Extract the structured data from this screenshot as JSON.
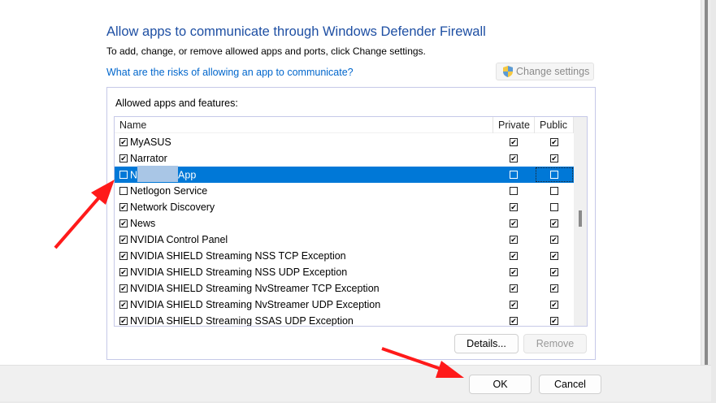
{
  "title": "Allow apps to communicate through Windows Defender Firewall",
  "subtitle": "To add, change, or remove allowed apps and ports, click Change settings.",
  "risk_link": "What are the risks of allowing an app to communicate?",
  "change_settings": "Change settings",
  "group_label": "Allowed apps and features:",
  "columns": {
    "name": "Name",
    "private": "Private",
    "public": "Public"
  },
  "rows": [
    {
      "name": "MyASUS",
      "enabled": true,
      "private": true,
      "public": true
    },
    {
      "name": "Narrator",
      "enabled": true,
      "private": true,
      "public": true
    },
    {
      "name_prefix": "N",
      "name": "App",
      "enabled": false,
      "private": false,
      "public": false,
      "selected": true
    },
    {
      "name": "Netlogon Service",
      "enabled": false,
      "private": false,
      "public": false
    },
    {
      "name": "Network Discovery",
      "enabled": true,
      "private": true,
      "public": false
    },
    {
      "name": "News",
      "enabled": true,
      "private": true,
      "public": true
    },
    {
      "name": "NVIDIA Control Panel",
      "enabled": true,
      "private": true,
      "public": true
    },
    {
      "name": "NVIDIA SHIELD Streaming NSS TCP Exception",
      "enabled": true,
      "private": true,
      "public": true
    },
    {
      "name": "NVIDIA SHIELD Streaming NSS UDP Exception",
      "enabled": true,
      "private": true,
      "public": true
    },
    {
      "name": "NVIDIA SHIELD Streaming NvStreamer TCP Exception",
      "enabled": true,
      "private": true,
      "public": true
    },
    {
      "name": "NVIDIA SHIELD Streaming NvStreamer UDP Exception",
      "enabled": true,
      "private": true,
      "public": true
    },
    {
      "name": "NVIDIA SHIELD Streaming SSAS UDP Exception",
      "enabled": true,
      "private": true,
      "public": true
    }
  ],
  "details_button": "Details...",
  "remove_button": "Remove",
  "ok_button": "OK",
  "cancel_button": "Cancel",
  "colors": {
    "accent": "#0078d7",
    "title": "#1e4fa3",
    "link": "#0066cc",
    "arrow": "#ff1a1a"
  }
}
